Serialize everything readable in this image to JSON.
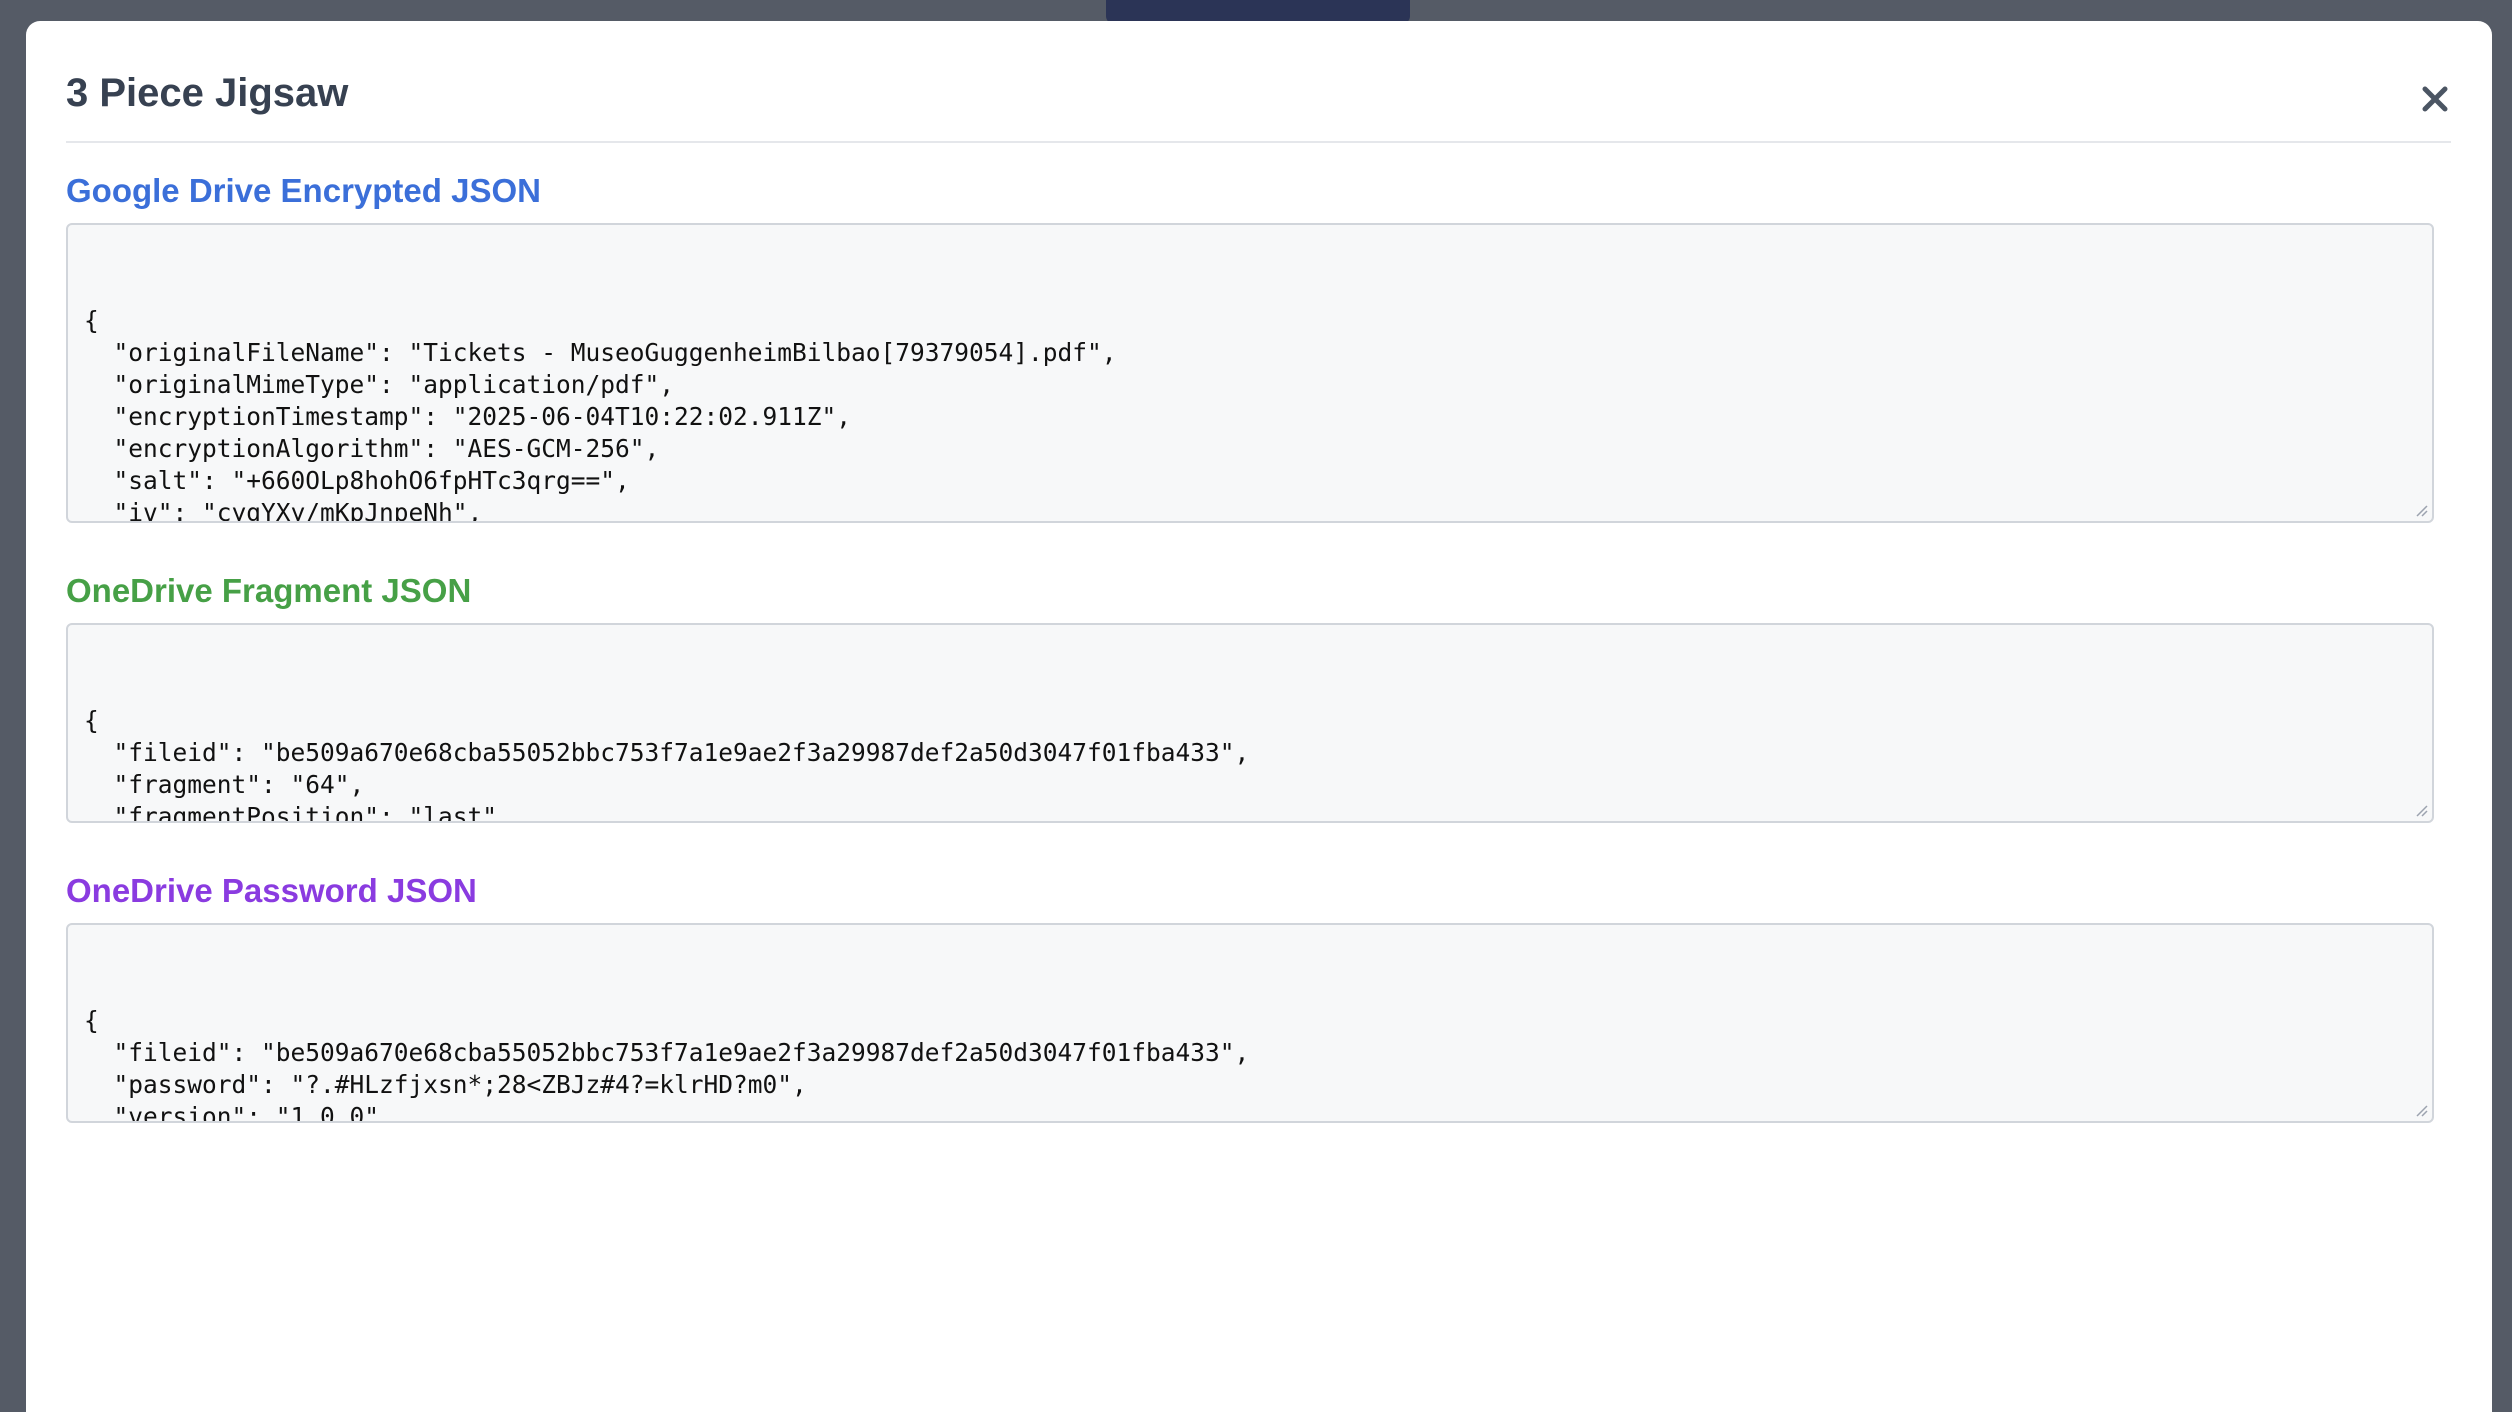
{
  "modal": {
    "title": "3 Piece Jigsaw",
    "close_icon": "close-icon"
  },
  "sections": [
    {
      "title": "Google Drive Encrypted JSON",
      "color": "#3b6fd9",
      "content": "{\n  \"originalFileName\": \"Tickets - MuseoGuggenheimBilbao[79379054].pdf\",\n  \"originalMimeType\": \"application/pdf\",\n  \"encryptionTimestamp\": \"2025-06-04T10:22:02.911Z\",\n  \"encryptionAlgorithm\": \"AES-GCM-256\",\n  \"salt\": \"+660OLp8hohO6fpHTc3qrg==\",\n  \"iv\": \"cygYXy/mKpJnpeNh\",\n  \"encryptedDataChunk\": \"eRgxoas9ZZYfnYPjEzzdR6q68mnYKdEjoNeQMnQEmZO5bYAJHSROslmWTJO2GF3QqeIyxvddveIvt0G+r5Ah89RU2Cp0xE/lshHKaZQDLQxjDowAaoGJcoTYLgfusQFp5BW7Tuwq\n4f+KzN6oNjfv/XfF/qS0+5U+JNlBPOqqztq+eC/3qavdpeVNRbrZ00OiWPAnSE03tkqOaqdzHTJD5iqubL7bUbeG4Id+Y7D6tSSJDvCJE15NZBJZvdkFSOqlddv33HTSCqqivD6MeP7+Wc52hbU8p7uaLqRxwTbPD"
    },
    {
      "title": "OneDrive Fragment JSON",
      "color": "#46a046",
      "content": "{\n  \"fileid\": \"be509a670e68cba55052bbc753f7a1e9ae2f3a29987def2a50d3047f01fba433\",\n  \"fragment\": \"64\",\n  \"fragmentPosition\": \"last\",\n  \"fragmentData\": \"RIuifLoqwnYgo+elK/XSsn6ktds1b7b2AXBVwbO3wKSy1s5wDuRE4jwSkBxqKw==\"\n}"
    },
    {
      "title": "OneDrive Password JSON",
      "color": "#8a3be0",
      "content": "{\n  \"fileid\": \"be509a670e68cba55052bbc753f7a1e9ae2f3a29987def2a50d3047f01fba433\",\n  \"password\": \"?.#HLzfjxsn*;28<ZBJz#4?=klrHD?m0\",\n  \"version\": \"1.0.0\"\n}"
    }
  ]
}
